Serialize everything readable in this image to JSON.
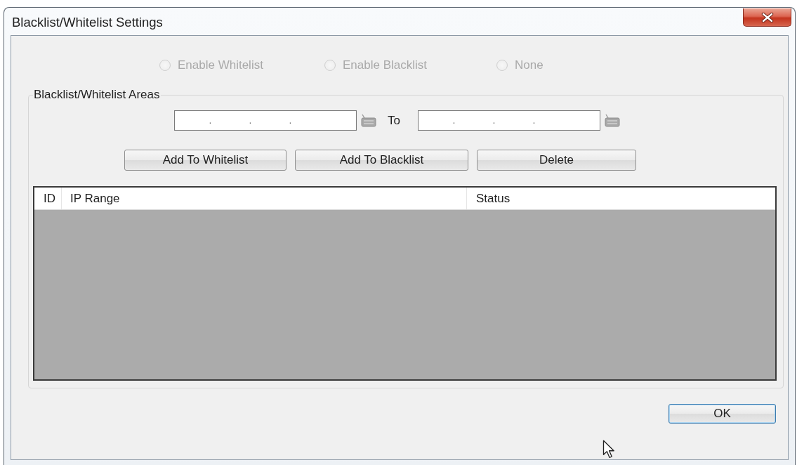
{
  "window": {
    "title": "Blacklist/Whitelist Settings"
  },
  "mode_options": [
    {
      "label": "Enable Whitelist",
      "selected": false,
      "disabled": true
    },
    {
      "label": "Enable Blacklist",
      "selected": false,
      "disabled": true
    },
    {
      "label": "None",
      "selected": false,
      "disabled": true
    }
  ],
  "areas": {
    "title": "Blacklist/Whitelist Areas",
    "start_ip": {
      "separators": [
        ".",
        ".",
        "."
      ]
    },
    "to_label": "To",
    "end_ip": {
      "separators": [
        ".",
        ".",
        "."
      ]
    },
    "buttons": [
      "Add To Whitelist",
      "Add To Blacklist",
      "Delete"
    ]
  },
  "table": {
    "columns": [
      "ID",
      "IP Range",
      "Status"
    ]
  },
  "ok_button": {
    "label": "OK",
    "focused": true
  }
}
